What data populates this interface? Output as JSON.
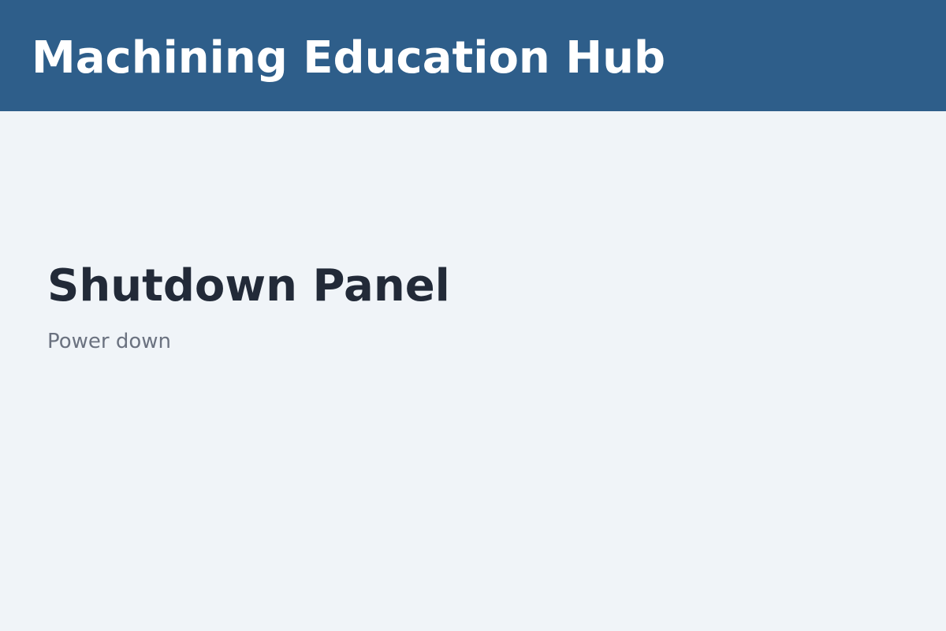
{
  "header": {
    "title": "Machining Education Hub"
  },
  "panel": {
    "title": "Shutdown Panel",
    "subtitle": "Power down"
  },
  "colors": {
    "header_background": "#2e5e8a",
    "page_background": "#f0f4f8",
    "title_text": "#222a38",
    "subtitle_text": "#6b7280"
  }
}
